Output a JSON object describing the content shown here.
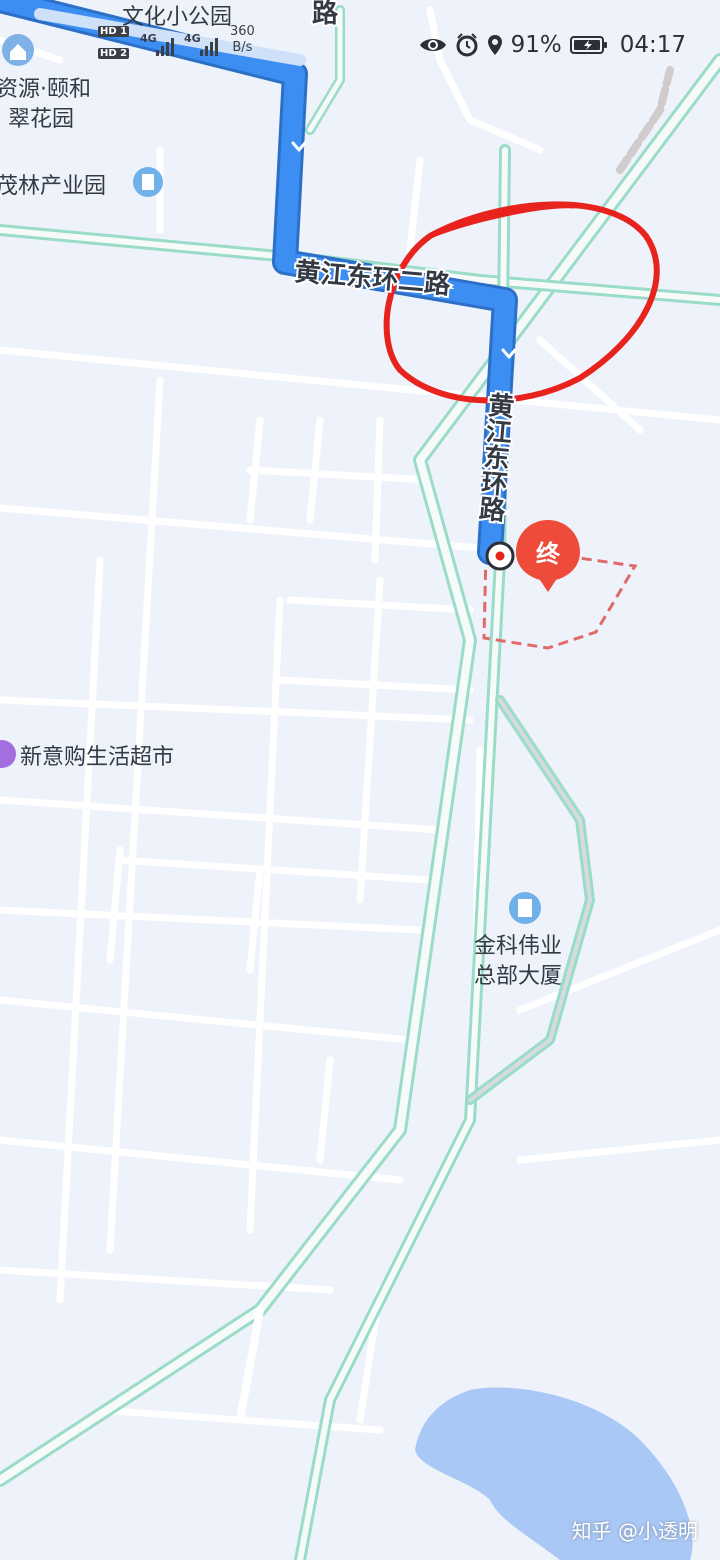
{
  "status_bar": {
    "time": "04:17",
    "battery_percent": "91%",
    "network_speed": "360",
    "network_speed_unit": "B/s",
    "sim1": "HD 1",
    "sim2": "HD 2",
    "net_type_1": "4G",
    "net_type_2": "4G",
    "icons": [
      "eye-icon",
      "alarm-icon",
      "location-icon",
      "battery-icon"
    ]
  },
  "map": {
    "places": [
      {
        "name": "文化小公园"
      },
      {
        "name_line1": "资源·颐和",
        "name_line2": "翠花园"
      },
      {
        "name": "茂林产业园"
      },
      {
        "name": "新意购生活超市"
      },
      {
        "name_line1": "金科伟业",
        "name_line2": "总部大厦"
      }
    ],
    "roads": {
      "top": "路",
      "horizontal": "黄江东环二路",
      "vertical": "黄江东环路"
    },
    "destination_marker": "终",
    "route_color": "#3d8ef2",
    "annotation_color": "#e8221c"
  },
  "watermark": "知乎 @小透明"
}
